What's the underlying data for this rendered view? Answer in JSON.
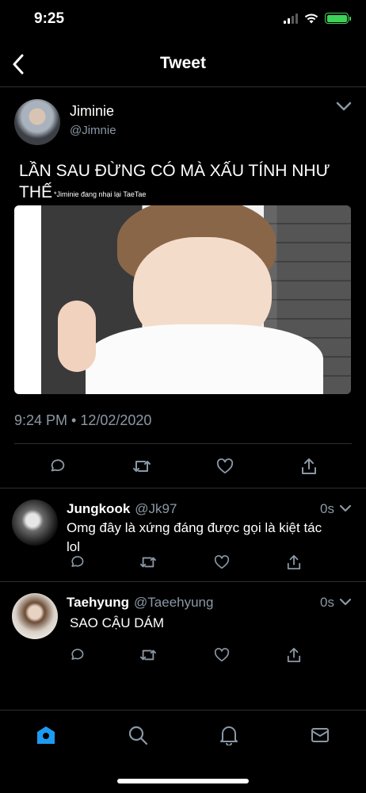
{
  "status_bar": {
    "time": "9:25",
    "icons": [
      "cellular-signal-icon",
      "wifi-icon",
      "battery-charging-icon"
    ],
    "battery_color": "#3fd15a"
  },
  "header": {
    "title": "Tweet",
    "back_icon": "back-arrow-icon"
  },
  "tweet": {
    "author_name": "Jiminie",
    "author_handle": "@Jimnie",
    "text": "LẦN SAU ĐỪNG CÓ MÀ XẤU TÍNH NHƯ THẾ",
    "text_note": "*Jiminie đang nhại lại TaeTae",
    "timestamp": "9:24 PM • 12/02/2020",
    "actions": [
      "reply-icon",
      "retweet-icon",
      "like-icon",
      "share-icon"
    ]
  },
  "replies": [
    {
      "name": "Jungkook",
      "handle": "@Jk97",
      "time": "0s",
      "text": "Omg đây là xứng đáng được gọi là kiệt tác lol"
    },
    {
      "name": "Taehyung",
      "handle": "@Taeehyung",
      "time": "0s",
      "text": "SAO CẬU DÁM"
    }
  ],
  "tab_bar": {
    "items": [
      "home-icon",
      "search-icon",
      "notifications-icon",
      "messages-icon"
    ],
    "active": "home-icon",
    "accent": "#1d9bf0"
  },
  "colors": {
    "background": "#000000",
    "text": "#ffffff",
    "secondary_text": "#8b98a5",
    "divider": "#2f2f2f"
  }
}
